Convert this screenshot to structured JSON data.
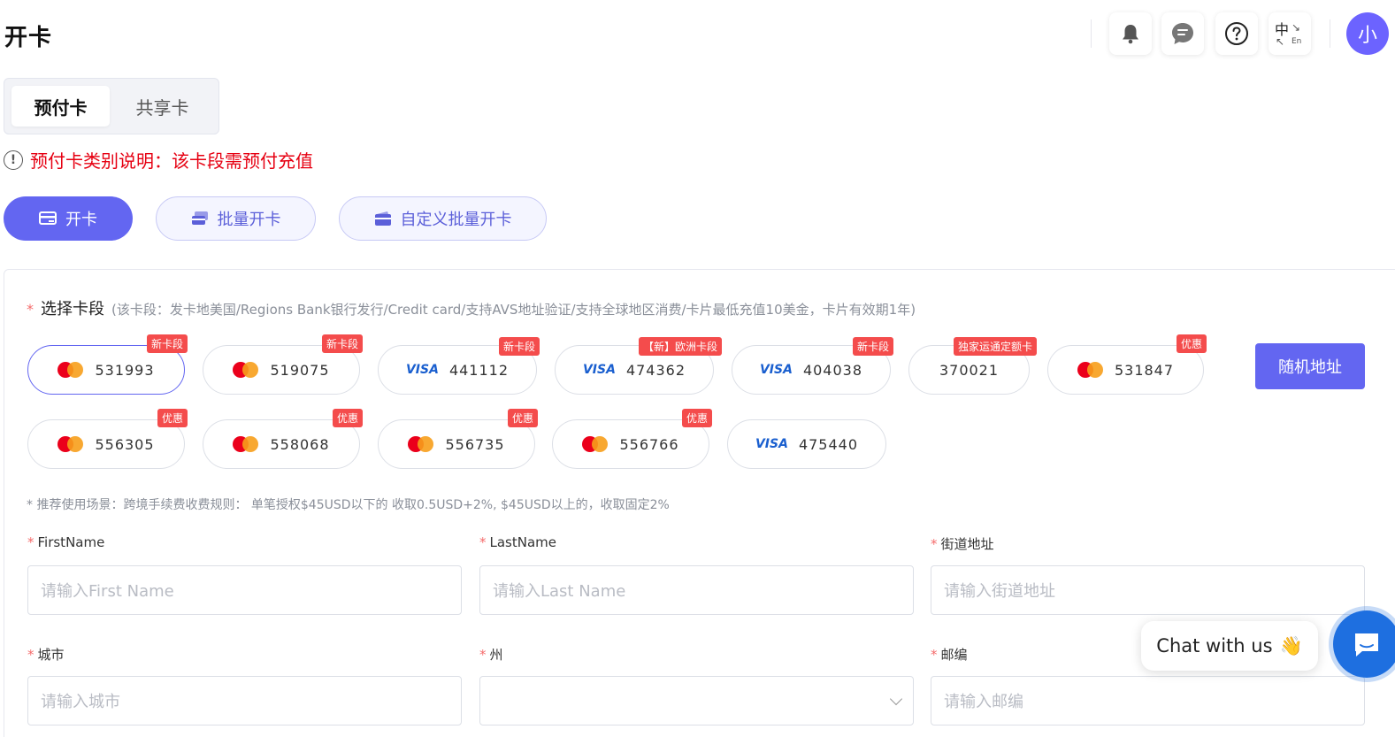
{
  "header": {
    "title": "开卡",
    "avatar_text": "小",
    "lang_icon": {
      "zh": "中",
      "en": "En"
    }
  },
  "tabs": [
    {
      "label": "预付卡",
      "active": true
    },
    {
      "label": "共享卡",
      "active": false
    }
  ],
  "notice": "预付卡类别说明：该卡段需预付充值",
  "actions": {
    "open_card": "开卡",
    "batch_open": "批量开卡",
    "custom_batch_open": "自定义批量开卡"
  },
  "card_section": {
    "required_mark": "*",
    "label": "选择卡段",
    "description": "(该卡段：发卡地美国/Regions Bank银行发行/Credit card/支持AVS地址验证/支持全球地区消费/卡片最低充值10美金，卡片有效期1年)",
    "random_address": "随机地址",
    "cards": [
      {
        "bin": "531993",
        "brand": "mastercard",
        "badge": "新卡段",
        "selected": true
      },
      {
        "bin": "519075",
        "brand": "mastercard",
        "badge": "新卡段",
        "selected": false
      },
      {
        "bin": "441112",
        "brand": "visa",
        "badge": "新卡段",
        "selected": false
      },
      {
        "bin": "474362",
        "brand": "visa",
        "badge": "【新】欧洲卡段",
        "selected": false
      },
      {
        "bin": "404038",
        "brand": "visa",
        "badge": "新卡段",
        "selected": false
      },
      {
        "bin": "370021",
        "brand": "none",
        "badge": "独家运通定额卡",
        "selected": false
      },
      {
        "bin": "531847",
        "brand": "mastercard",
        "badge": "优惠",
        "selected": false
      },
      {
        "bin": "556305",
        "brand": "mastercard",
        "badge": "优惠",
        "selected": false
      },
      {
        "bin": "558068",
        "brand": "mastercard",
        "badge": "优惠",
        "selected": false
      },
      {
        "bin": "556735",
        "brand": "mastercard",
        "badge": "优惠",
        "selected": false
      },
      {
        "bin": "556766",
        "brand": "mastercard",
        "badge": "优惠",
        "selected": false
      },
      {
        "bin": "475440",
        "brand": "visa",
        "badge": "",
        "selected": false
      }
    ],
    "visa_text": "VISA",
    "tip": "* 推荐使用场景：跨境手续费收费规则： 单笔授权$45USD以下的 收取0.5USD+2%, $45USD以上的，收取固定2%"
  },
  "form": {
    "required_mark": "*",
    "fields": [
      {
        "label": "FirstName",
        "placeholder": "请输入First Name"
      },
      {
        "label": "LastName",
        "placeholder": "请输入Last Name"
      },
      {
        "label": "街道地址",
        "placeholder": "请输入街道地址"
      },
      {
        "label": "城市",
        "placeholder": "请输入城市"
      },
      {
        "label": "州",
        "placeholder": ""
      },
      {
        "label": "邮编",
        "placeholder": "请输入邮编"
      }
    ]
  },
  "chat": {
    "text": "Chat with us",
    "emoji": "👋"
  },
  "colors": {
    "primary": "#6366f1",
    "danger": "#e60012",
    "badge": "#f44c4c",
    "chat_fab": "#1e6fe0"
  }
}
